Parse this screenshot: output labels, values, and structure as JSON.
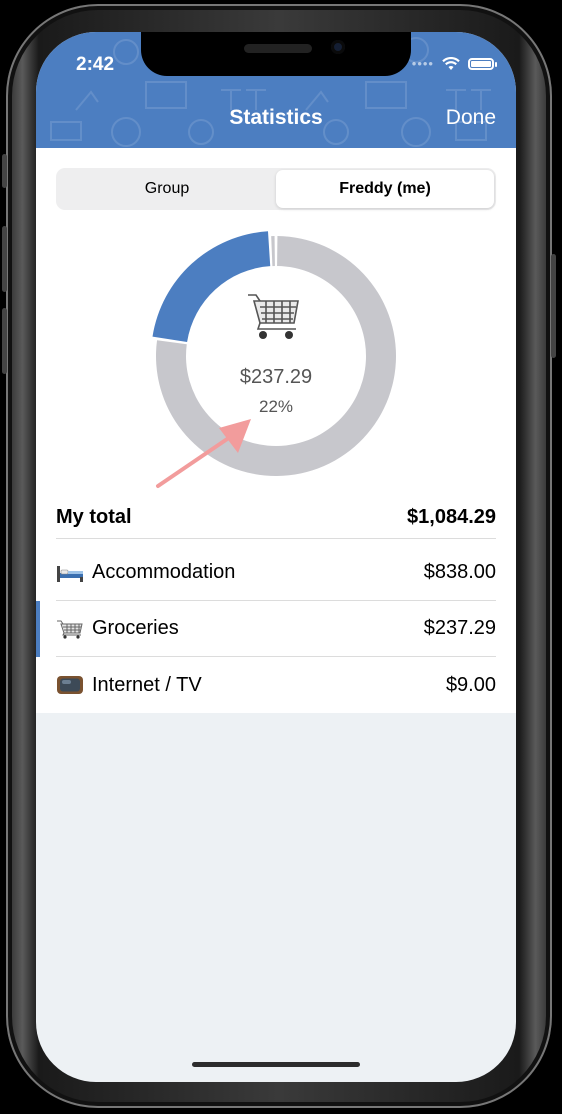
{
  "status_bar": {
    "time": "2:42"
  },
  "nav": {
    "title": "Statistics",
    "done_label": "Done"
  },
  "segmented": {
    "options": [
      "Group",
      "Freddy (me)"
    ],
    "selected_index": 1
  },
  "center": {
    "amount": "$237.29",
    "percent": "22%",
    "icon": "shopping-cart-icon"
  },
  "total": {
    "label": "My total",
    "value": "$1,084.29"
  },
  "categories": [
    {
      "icon": "bed-icon",
      "label": "Accommodation",
      "value": "$838.00"
    },
    {
      "icon": "shopping-cart-icon",
      "label": "Groceries",
      "value": "$237.29",
      "selected": true
    },
    {
      "icon": "tv-icon",
      "label": "Internet / TV",
      "value": "$9.00"
    }
  ],
  "chart_data": {
    "type": "pie",
    "categories": [
      "Accommodation",
      "Groceries",
      "Internet / TV"
    ],
    "values": [
      838.0,
      237.29,
      9.0
    ],
    "highlighted": "Groceries"
  },
  "colors": {
    "accent": "#4c7ec1",
    "ring_gray": "#c7c7cc",
    "arrow": "#f29c9c"
  }
}
